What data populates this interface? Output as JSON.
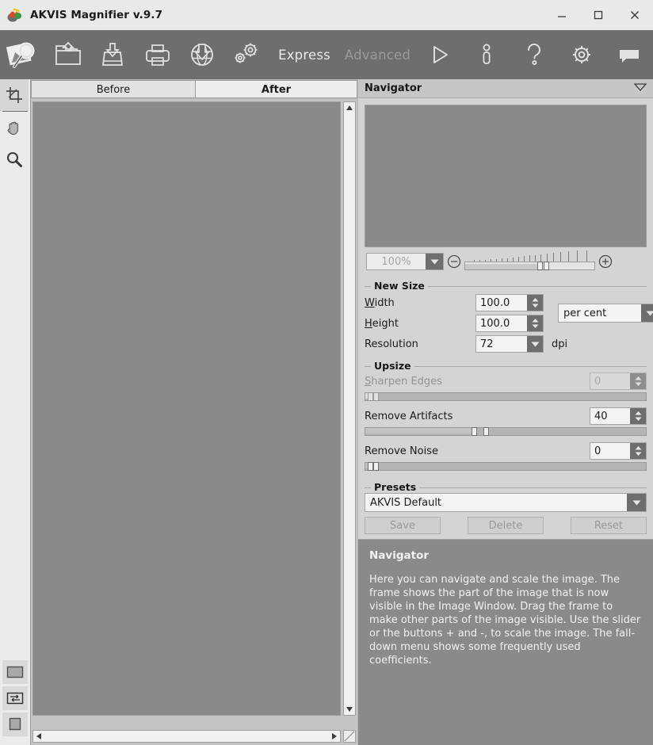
{
  "window": {
    "title": "AKVIS Magnifier v.9.7",
    "app_icon": "akvis-logo-icon",
    "minimize_label": "Minimize",
    "maximize_label": "Maximize",
    "close_label": "Close"
  },
  "toolbar": {
    "icons": [
      {
        "name": "akvis-magnifier-logo-icon",
        "label": "AKVIS Magnifier"
      },
      {
        "name": "open-image-icon",
        "label": "Open Image"
      },
      {
        "name": "save-image-icon",
        "label": "Save Image"
      },
      {
        "name": "print-image-icon",
        "label": "Print Image"
      },
      {
        "name": "publish-image-icon",
        "label": "Publish Image"
      },
      {
        "name": "preferences-gears-icon",
        "label": "Preferences"
      }
    ],
    "mode_express": "Express",
    "mode_advanced": "Advanced",
    "run_label": "Run",
    "about_label": "About",
    "help_label": "Help",
    "settings_label": "Settings",
    "comments_label": "Comments"
  },
  "tools": [
    {
      "name": "crop-tool",
      "label": "Crop",
      "selected": true
    },
    {
      "name": "hand-tool",
      "label": "Hand",
      "selected": false
    },
    {
      "name": "zoom-tool",
      "label": "Zoom",
      "selected": false
    }
  ],
  "bottom_tools": [
    {
      "name": "fit-to-window-button",
      "label": "Fit to Window"
    },
    {
      "name": "compare-split-button",
      "label": "Compare"
    },
    {
      "name": "actual-size-button",
      "label": "Actual Size"
    }
  ],
  "image_tabs": {
    "before": "Before",
    "after": "After",
    "active": "After"
  },
  "scrollbars": {
    "up_arrow": "scroll-up-arrow",
    "down_arrow": "scroll-down-arrow",
    "left_arrow": "scroll-left-arrow",
    "right_arrow": "scroll-right-arrow",
    "resize_grip": "resize-grip"
  },
  "navigator": {
    "title": "Navigator",
    "collapse_icon": "chevron-down-icon",
    "zoom_value": "100%",
    "zoom_out_icon": "zoom-out-circle-icon",
    "zoom_in_icon": "zoom-in-circle-icon",
    "slider_percent": 59
  },
  "new_size": {
    "legend": "New Size",
    "width_label": "Width",
    "width_accel": "W",
    "width_value": "100.0",
    "height_label": "Height",
    "height_accel": "H",
    "height_value": "100.0",
    "resolution_label": "Resolution",
    "resolution_value": "72",
    "unit_value": "per cent",
    "dpi_label": "dpi"
  },
  "upsize": {
    "legend": "Upsize",
    "params": [
      {
        "label": "Sharpen Edges",
        "accel": "S",
        "value": "0",
        "disabled": true,
        "slider_percent": 2
      },
      {
        "label": "Remove Artifacts",
        "accel": "",
        "value": "40",
        "disabled": false,
        "slider_percent": 40
      },
      {
        "label": "Remove Noise",
        "accel": "",
        "value": "0",
        "disabled": false,
        "slider_percent": 2
      }
    ]
  },
  "presets": {
    "legend": "Presets",
    "selected": "AKVIS Default",
    "save_label": "Save",
    "delete_label": "Delete",
    "reset_label": "Reset"
  },
  "hints": {
    "title": "Navigator",
    "text": "Here you can navigate and scale the image. The frame shows the part of the image that is now visible in the Image Window. Drag the frame to make other parts of the image visible. Use the slider or the buttons + and -, to scale the image. The fall-down menu shows some frequently used coefficients."
  },
  "colors": {
    "titlebar": "#e9e9e9",
    "toolbar": "#6e6e6e",
    "panel": "#d4d4d4",
    "canvas": "#8a8a8a",
    "hints_bg": "#8a8a8a",
    "accent_dark": "#6e6e6e"
  }
}
